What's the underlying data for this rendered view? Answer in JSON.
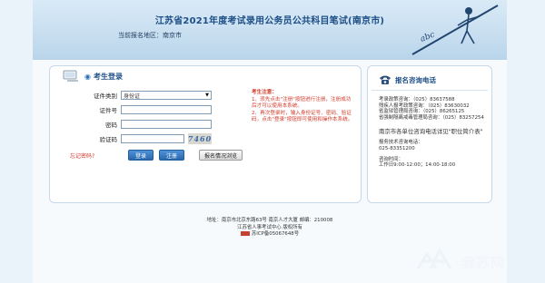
{
  "header": {
    "title": "江苏省2021年度考试录用公务员公共科目笔试(南京市)",
    "region_label": "当前报名地区：",
    "region_value": "南京市"
  },
  "login": {
    "heading": "考生登录",
    "fields": {
      "id_type_label": "证件类别",
      "id_type_value": "身份证",
      "id_number_label": "证件号",
      "password_label": "密码",
      "captcha_label": "验证码",
      "captcha_image_text": "7460"
    },
    "forgot_password": "忘记密码?",
    "buttons": {
      "login": "登录",
      "register": "注册",
      "check_status": "报名情况浏览"
    },
    "notice": {
      "heading": "考生注意：",
      "items": [
        "1、须先点击\"注册\"按钮进行注册，注册成功后才可以使用本系统。",
        "2、再次登录时，输入身份证号、密码、验证码，点击\"登录\"按钮即可使用和操作本系统。"
      ]
    }
  },
  "hotline": {
    "heading": "报名咨询电话",
    "lines": [
      "考录政策咨询：（025）83637588",
      "残疾人报考政策咨询：（025）83630032",
      "省监狱管理局咨询：（025）86265125",
      "省强制隔离戒毒管理局咨询：（025）83257254"
    ],
    "city_note": "南京市各单位咨询电话详见\"职位简介表\"",
    "tech_label": "报务技术咨询电话：",
    "tech_phone": "025-83351200",
    "hours_label": "咨询时间：",
    "hours_value": "工作日9:00-12:00；14:00-18:00"
  },
  "footer": {
    "address": "地址：南京市北京东路63号  南京人才大厦  邮编：210008",
    "copyright": "江苏省人事考试中心  版权所有",
    "icp": "苏ICP备05067648号"
  },
  "watermark": {
    "text": "我苏网"
  },
  "colors": {
    "accent": "#1d4e86",
    "notice_red": "#d23a2a",
    "button_blue": "#2a68ad"
  }
}
